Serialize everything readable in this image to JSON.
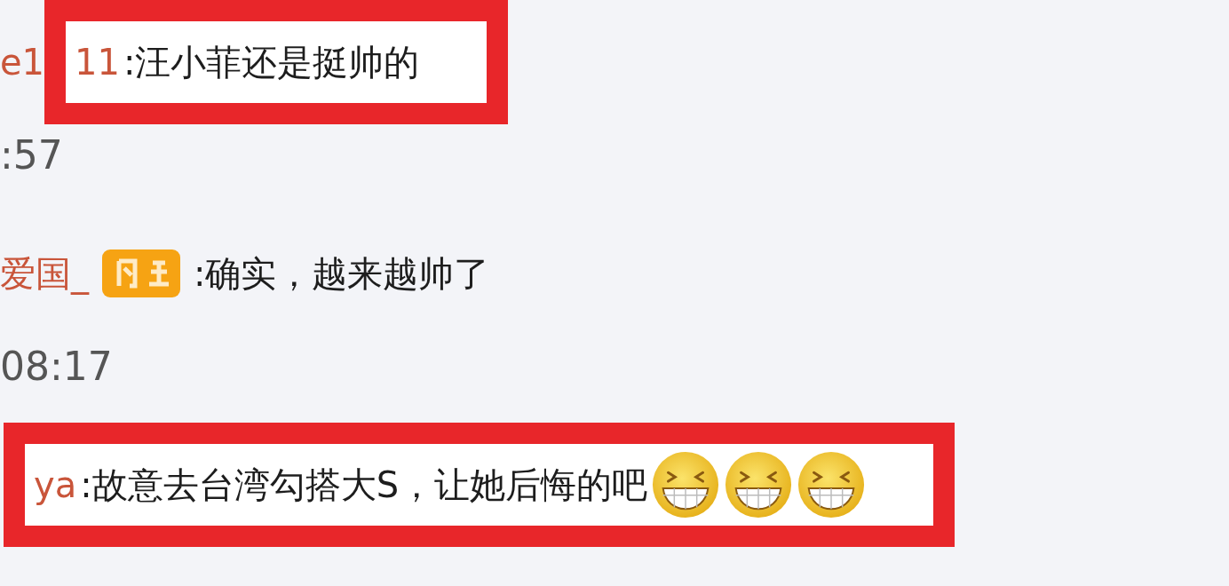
{
  "comments": [
    {
      "user_prefix": "e1",
      "user": "11",
      "text": ":汪小菲还是挺帅的",
      "highlighted": true,
      "time": ":57"
    },
    {
      "user": "爱国_",
      "badge": true,
      "text": ":确实，越来越帅了",
      "highlighted": false,
      "time": "08:17"
    },
    {
      "user": "ya",
      "text": ":故意去台湾勾搭大S，让她后悔的吧",
      "emojis": [
        {
          "kind": "grin"
        },
        {
          "kind": "grin"
        },
        {
          "kind": "grin"
        }
      ],
      "highlighted": true
    }
  ]
}
